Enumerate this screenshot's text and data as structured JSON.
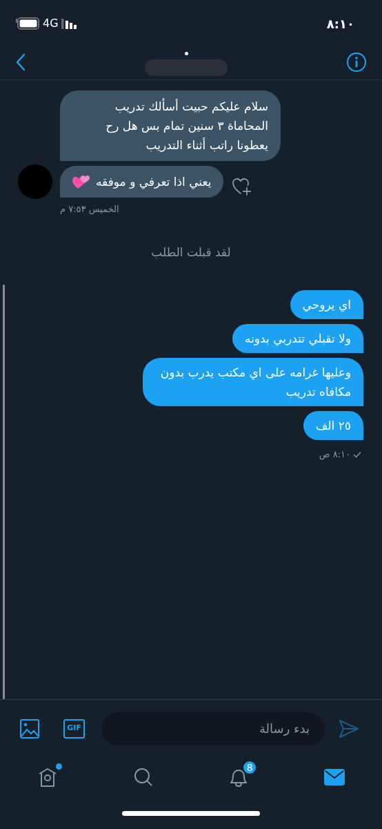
{
  "status_bar": {
    "time": "٨:١٠",
    "network": "4G"
  },
  "conversation": [
    {
      "kind": "received",
      "text": "سلام عليكم حبيت أسألك تدريب المحاماة ٣ سنين تمام بس هل رح يعطونا راتب أثناء التدريب",
      "avatar": false,
      "emoji": false,
      "react_button": false
    },
    {
      "kind": "received",
      "text": "يعني اذا تعرفي و موفقه",
      "avatar": true,
      "emoji": true,
      "react_button": true
    },
    {
      "kind": "received_time",
      "text": "الخميس ٧:٥٣ م"
    },
    {
      "kind": "notice",
      "text": "لقد قبلت الطلب"
    },
    {
      "kind": "sent",
      "text": "اي يروحي"
    },
    {
      "kind": "sent",
      "text": "ولا تقبلي تتدربي بدونه"
    },
    {
      "kind": "sent",
      "text": "وعليها غرامه على اي مكتب يدرب بدون مكافاه تدريب"
    },
    {
      "kind": "sent",
      "text": "٢٥ الف"
    },
    {
      "kind": "sent_time",
      "text": "٨:١٠ ص",
      "delivered": true
    }
  ],
  "composer": {
    "gif_label": "GIF",
    "placeholder": "بدء رسالة"
  },
  "tabs": [
    {
      "kind": "home",
      "selected": false,
      "dot": true
    },
    {
      "kind": "search",
      "selected": false,
      "dot": false
    },
    {
      "kind": "notifications",
      "selected": false,
      "dot": false,
      "badge": "8"
    },
    {
      "kind": "messages",
      "selected": true,
      "dot": false
    }
  ]
}
